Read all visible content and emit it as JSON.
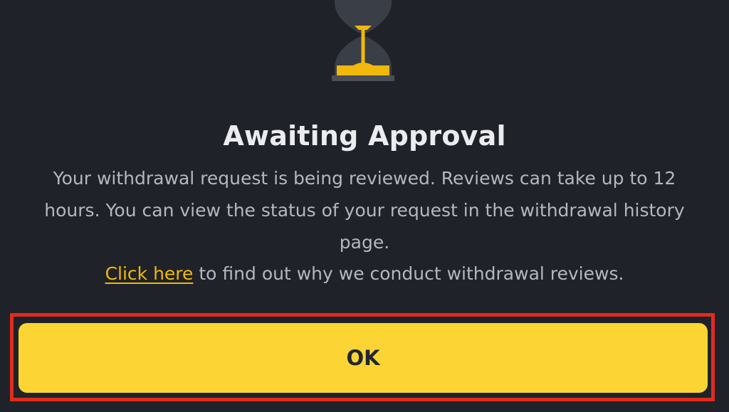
{
  "dialog": {
    "icon": "hourglass-icon",
    "title": "Awaiting Approval",
    "description_lines": [
      "Your withdrawal request is being reviewed. Reviews can take up to 12",
      "hours. You can view the status of your request in the withdrawal history",
      "page."
    ],
    "help": {
      "link_text": "Click here",
      "rest_text": " to find out why we conduct withdrawal reviews."
    },
    "ok_label": "OK"
  },
  "colors": {
    "background": "#1f2228",
    "accent": "#fcd535",
    "link": "#f0b90b",
    "title": "#eaecef",
    "body_text": "#b3b8c0",
    "highlight_frame": "#e22b1c"
  }
}
